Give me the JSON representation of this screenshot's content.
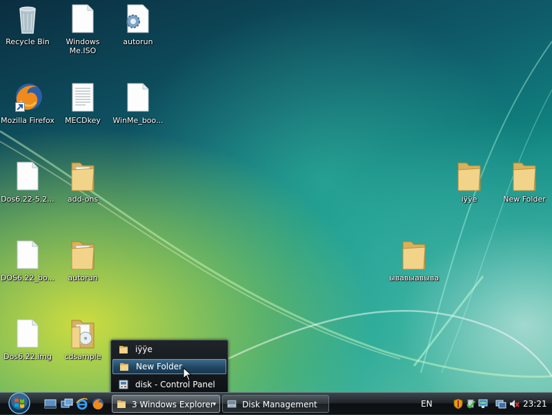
{
  "desktop": {
    "icons": [
      {
        "id": "recycle-bin",
        "label": "Recycle Bin",
        "type": "recycle"
      },
      {
        "id": "windows-me-iso",
        "label": "Windows Me.ISO",
        "type": "file"
      },
      {
        "id": "autorun-exe",
        "label": "autorun",
        "type": "gear"
      },
      {
        "id": "firefox",
        "label": "Mozilla Firefox",
        "type": "firefox"
      },
      {
        "id": "mecdkey",
        "label": "MECDkey",
        "type": "text"
      },
      {
        "id": "winme-boot",
        "label": "WinMe_boo...",
        "type": "file"
      },
      {
        "id": "dos622-52",
        "label": "Dos6.22-5.2...",
        "type": "file"
      },
      {
        "id": "add-ons",
        "label": "add-ons",
        "type": "folder-docs"
      },
      {
        "id": "iyye",
        "label": "iÿÿe",
        "type": "folder"
      },
      {
        "id": "new-folder",
        "label": "New Folder",
        "type": "folder"
      },
      {
        "id": "dos622-boot",
        "label": "DOS6.22_bo...",
        "type": "file"
      },
      {
        "id": "autorun-folder",
        "label": "autorun",
        "type": "folder-docs"
      },
      {
        "id": "yvayvayva",
        "label": "ывавыавыва",
        "type": "folder"
      },
      {
        "id": "dos622-img",
        "label": "Dos6.22.img",
        "type": "file"
      },
      {
        "id": "cdsample",
        "label": "cdsample",
        "type": "folder-cd"
      }
    ]
  },
  "popup": {
    "items": [
      {
        "label": "iÿÿe",
        "icon": "folder-icon",
        "highlighted": false
      },
      {
        "label": "New Folder",
        "icon": "folder-icon",
        "highlighted": true
      },
      {
        "label": "disk - Control Panel",
        "icon": "control-panel-icon",
        "highlighted": false
      }
    ]
  },
  "taskbar": {
    "quick_launch": [
      "show-desktop-icon",
      "switch-windows-icon",
      "internet-explorer-icon",
      "firefox-icon"
    ],
    "buttons": [
      {
        "label": "3 Windows Explorer",
        "icon": "folder-icon",
        "active": true,
        "arrow": "▾"
      },
      {
        "label": "Disk Management",
        "icon": "disk-management-icon",
        "active": false
      }
    ],
    "language": "EN",
    "tray_icons": [
      "security-shield-icon",
      "safely-remove-icon",
      "network-icon",
      "volume-muted-icon"
    ],
    "clock": "23:21"
  }
}
